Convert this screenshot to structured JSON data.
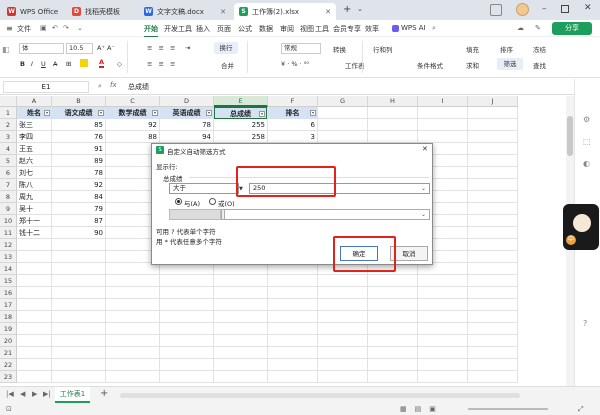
{
  "tabs": [
    {
      "label": "WPS Office",
      "icon": "W",
      "color": "#d3342e"
    },
    {
      "label": "找稻壳模板",
      "icon": "D",
      "color": "#e04a3b"
    },
    {
      "label": "文字文稿.docx",
      "icon": "W",
      "color": "#2b6ae0"
    },
    {
      "label": "工作簿(2).xlsx",
      "icon": "S",
      "color": "#1e9e5c"
    }
  ],
  "menu": {
    "file": "文件",
    "items": [
      "开始",
      "开发工具",
      "插入",
      "页面",
      "公式",
      "数据",
      "审阅",
      "视图",
      "工具",
      "会员专享",
      "效率"
    ],
    "ai": "WPS AI",
    "share": "分享"
  },
  "ribbon": {
    "font": "体",
    "size": "10.5",
    "wrap": "换行",
    "format": "常规",
    "convert": "转换",
    "rowcol": "行和列",
    "fill": "填充",
    "sort": "排序",
    "freeze": "冻结",
    "merge": "合并",
    "worksheet": "工作表",
    "condfmt": "条件格式",
    "sum": "求和",
    "filter": "筛选",
    "find": "查找"
  },
  "formula": {
    "cellref": "E1",
    "fx": "fx",
    "value": "总成绩"
  },
  "columns": [
    "A",
    "B",
    "C",
    "D",
    "E",
    "F",
    "G",
    "H",
    "I",
    "J"
  ],
  "rows": [
    "1",
    "2",
    "3",
    "4",
    "5",
    "6",
    "7",
    "8",
    "9",
    "10",
    "11",
    "12",
    "13",
    "14",
    "15",
    "16",
    "17",
    "18",
    "19",
    "20",
    "21",
    "22",
    "23"
  ],
  "table": {
    "headers": [
      "姓名",
      "语文成绩",
      "数学成绩",
      "英语成绩",
      "总成绩",
      "排名"
    ],
    "data": [
      [
        "张三",
        "85",
        "92",
        "78",
        "255",
        "6"
      ],
      [
        "李四",
        "76",
        "88",
        "94",
        "258",
        "3"
      ],
      [
        "王五",
        "91",
        "",
        "",
        "",
        ""
      ],
      [
        "赵六",
        "89",
        "",
        "",
        "",
        ""
      ],
      [
        "刘七",
        "78",
        "",
        "",
        "",
        ""
      ],
      [
        "陈八",
        "92",
        "",
        "",
        "",
        ""
      ],
      [
        "周九",
        "84",
        "",
        "",
        "",
        ""
      ],
      [
        "吴十",
        "79",
        "",
        "",
        "",
        ""
      ],
      [
        "郑十一",
        "87",
        "",
        "",
        "",
        ""
      ],
      [
        "钱十二",
        "90",
        "",
        "",
        "",
        ""
      ]
    ]
  },
  "dialog": {
    "title": "自定义自动筛选方式",
    "show_rows": "显示行:",
    "field": "总成绩",
    "op1": "大于",
    "val1": "250",
    "and": "与(A)",
    "or": "或(O)",
    "hint1": "可用 ? 代表单个字符",
    "hint2": "用 * 代表任意多个字符",
    "ok": "确定",
    "cancel": "取消"
  },
  "sheet": {
    "name": "工作表1"
  }
}
